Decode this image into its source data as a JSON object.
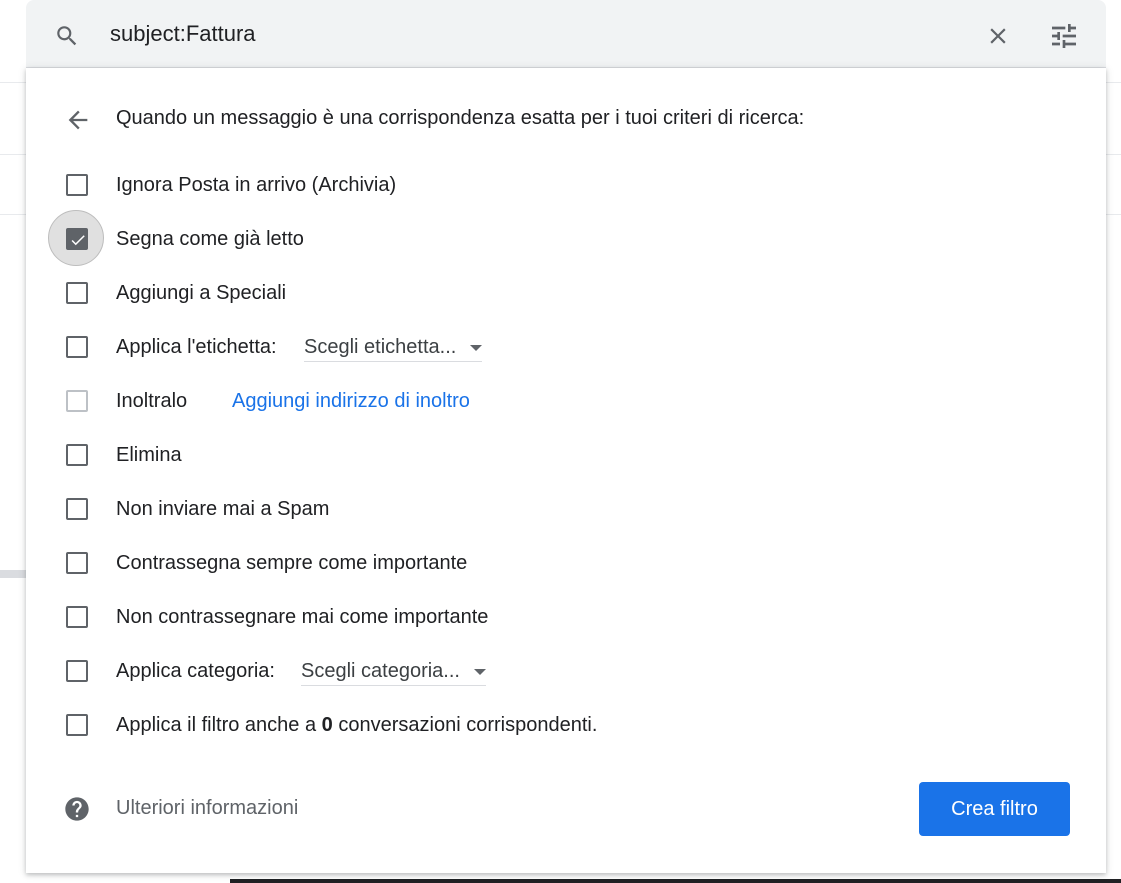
{
  "search": {
    "query": "subject:Fattura"
  },
  "filter": {
    "heading": "Quando un messaggio è una corrispondenza esatta per i tuoi criteri di ricerca:",
    "options": {
      "skip_inbox": "Ignora Posta in arrivo (Archivia)",
      "mark_read": "Segna come già letto",
      "star": "Aggiungi a Speciali",
      "apply_label": "Applica l'etichetta:",
      "forward": "Inoltralo",
      "delete": "Elimina",
      "never_spam": "Non inviare mai a Spam",
      "always_important": "Contrassegna sempre come importante",
      "never_important": "Non contrassegnare mai come importante",
      "categorize": "Applica categoria:",
      "also_apply_prefix": "Applica il filtro anche a",
      "also_apply_count": "0",
      "also_apply_suffix": "conversazioni corrispondenti."
    },
    "label_dropdown": "Scegli etichetta...",
    "category_dropdown": "Scegli categoria...",
    "forward_link": "Aggiungi indirizzo di inoltro",
    "checked": {
      "mark_read": true
    }
  },
  "footer": {
    "more_info": "Ulteriori informazioni",
    "create_button": "Crea filtro"
  },
  "colors": {
    "accent": "#1a73e8",
    "search_bg": "#f1f3f4",
    "checkbox": "#5f6368"
  }
}
